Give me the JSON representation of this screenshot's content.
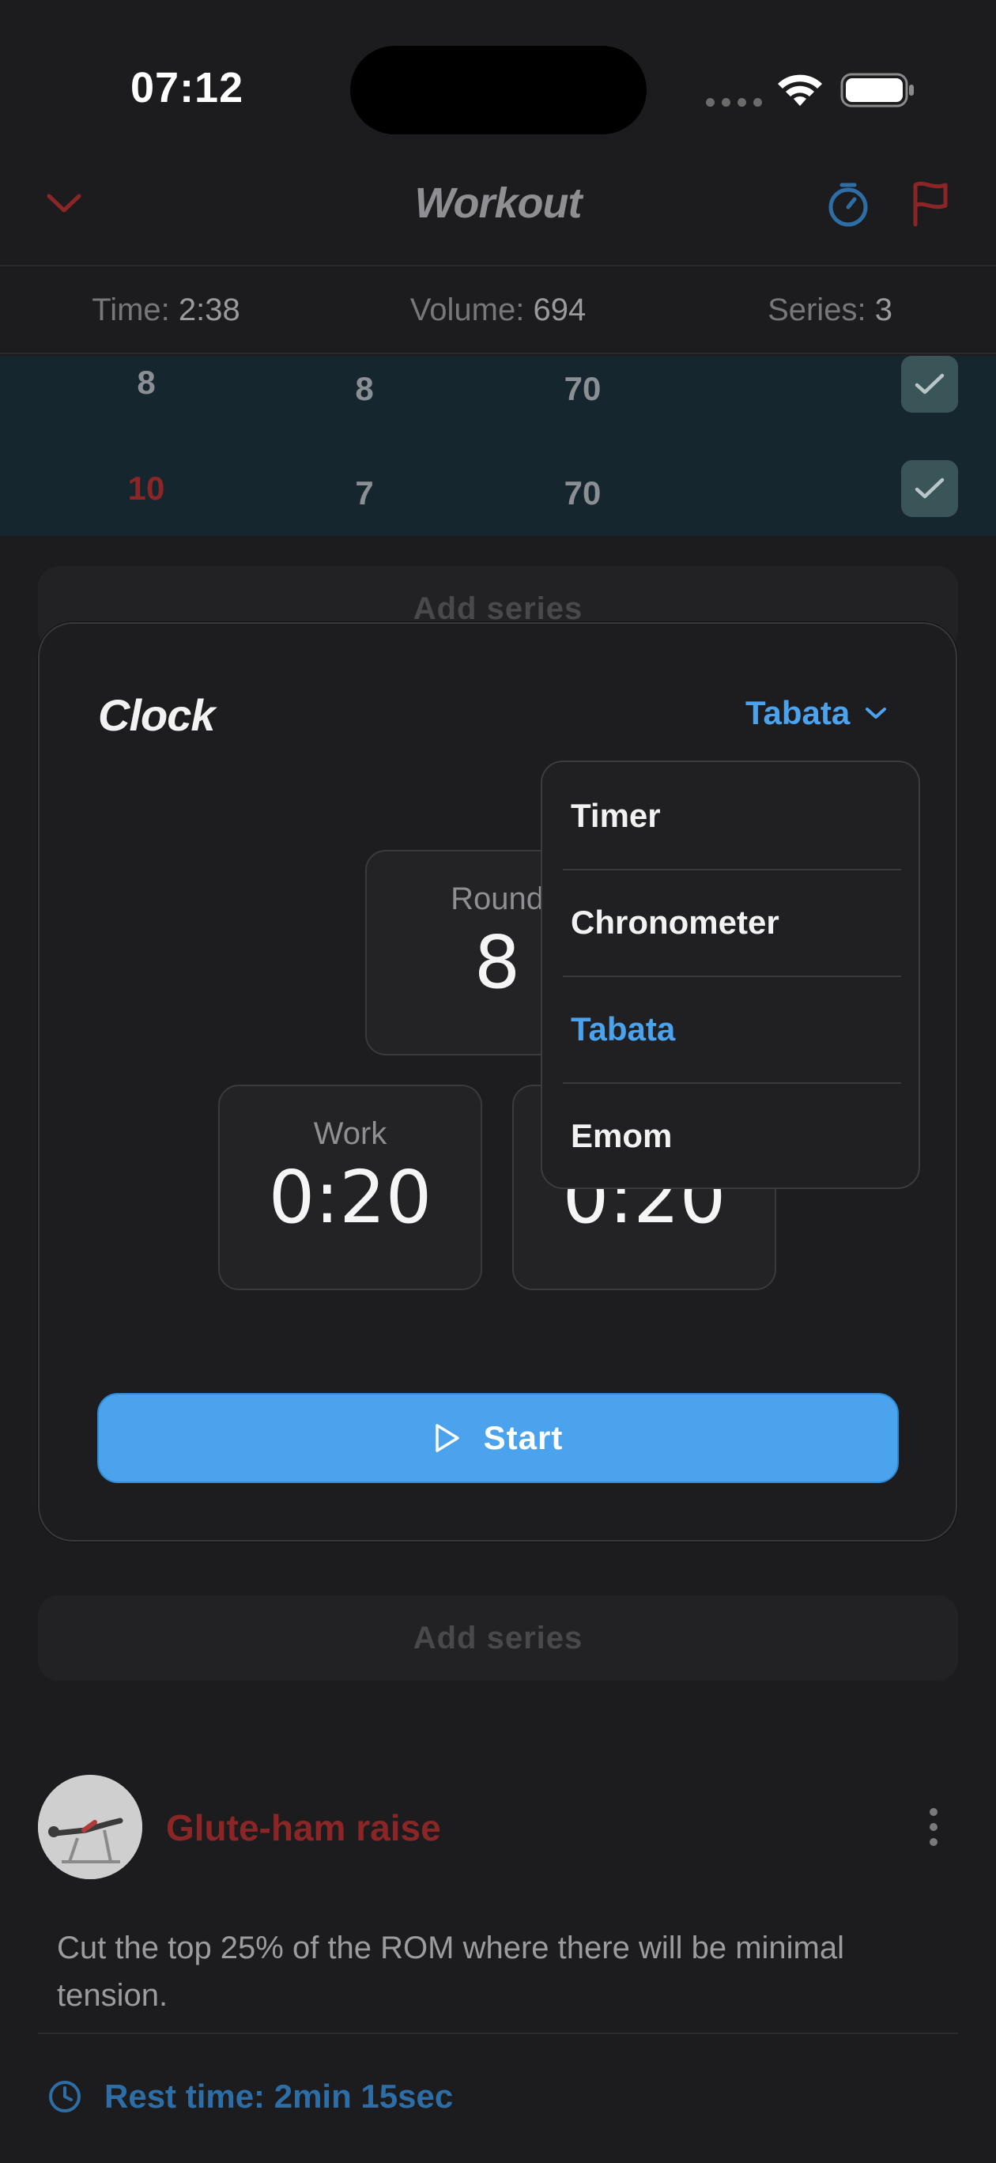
{
  "status_bar": {
    "time": "07:12"
  },
  "header": {
    "title": "Workout"
  },
  "stats": {
    "time_label": "Time:",
    "time_value": "2:38",
    "volume_label": "Volume:",
    "volume_value": "694",
    "series_label": "Series:",
    "series_value": "3"
  },
  "sets": [
    {
      "index": "8",
      "reps": "8",
      "weight": "70"
    },
    {
      "index": "10",
      "reps": "7",
      "weight": "70"
    }
  ],
  "add_series_label": "Add series",
  "clock": {
    "title": "Clock",
    "mode": "Tabata",
    "round_label": "Round",
    "round_value": "8",
    "work_label": "Work",
    "work_value": "0:20",
    "rest_value": "0:20",
    "start_label": "Start",
    "options": [
      "Timer",
      "Chronometer",
      "Tabata",
      "Emom"
    ],
    "selected_option": "Tabata"
  },
  "exercise": {
    "name": "Glute-ham raise",
    "note": "Cut the top 25% of the ROM where there will be minimal tension.",
    "rest_time": "Rest time: 2min 15sec"
  },
  "colors": {
    "accent_blue": "#4ba3ee",
    "accent_red": "#8c2626",
    "background": "#1c1c1e"
  }
}
